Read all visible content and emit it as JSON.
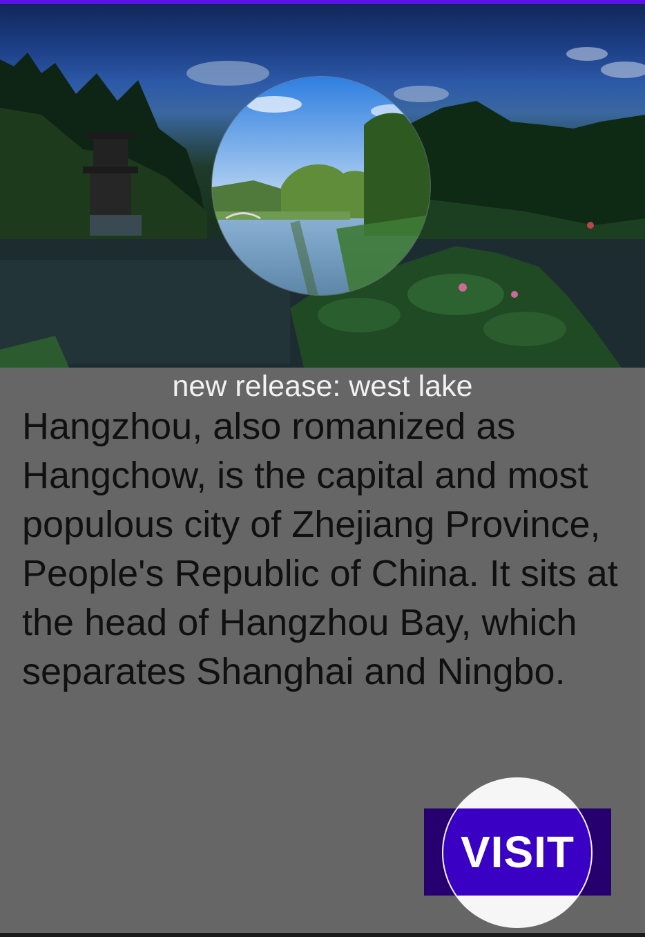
{
  "banner": {
    "image_alt": "West Lake landscape with pagoda, trees and lotus pond",
    "lens_alt": "Circular reveal of a bright lake with willow trees and stone bridge"
  },
  "release": {
    "title": "new release: west lake"
  },
  "article": {
    "body": "Hangzhou, also romanized as Hangchow, is the capital and most populous city of Zhejiang Province, People's Republic of China. It sits at the head of Hangzhou Bay, which separates Shanghai and Ningbo."
  },
  "actions": {
    "visit_label": "VISIT"
  },
  "colors": {
    "accent": "#5a12e6",
    "button_dark": "#25006e",
    "button": "#3a00c4",
    "panel_bg": "#666666"
  }
}
